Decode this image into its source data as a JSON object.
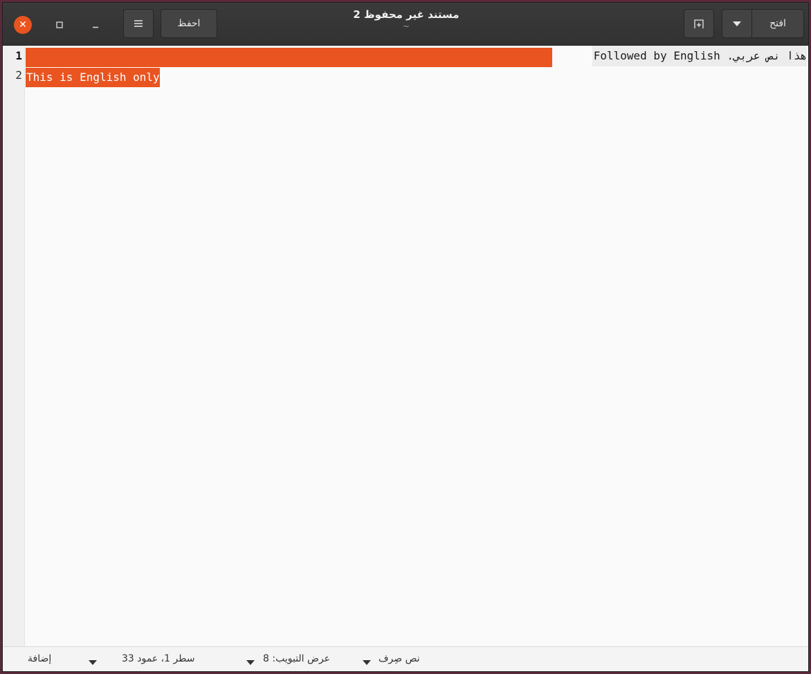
{
  "window": {
    "title": "مستند غير محفوظ 2",
    "subtitle": "~"
  },
  "header": {
    "open_label": "افتح",
    "save_label": "احفظ"
  },
  "editor": {
    "lines": [
      {
        "number": "1",
        "text": "هذا نص عربي. Followed by English"
      },
      {
        "number": "2",
        "text": "This is English only"
      }
    ]
  },
  "statusbar": {
    "mode_label": "إضافة",
    "position_label": "سطر 1، عمود 33",
    "tab_width_label": "عرض التبويب: 8",
    "language_label": "نص صِرف"
  },
  "colors": {
    "accent": "#e95420",
    "header_bg": "#353535"
  },
  "icons": {
    "close": "close-icon",
    "maximize": "maximize-icon",
    "minimize": "minimize-icon",
    "menu": "hamburger-menu-icon",
    "new_tab": "new-tab-icon",
    "dropdown": "chevron-down-icon"
  }
}
